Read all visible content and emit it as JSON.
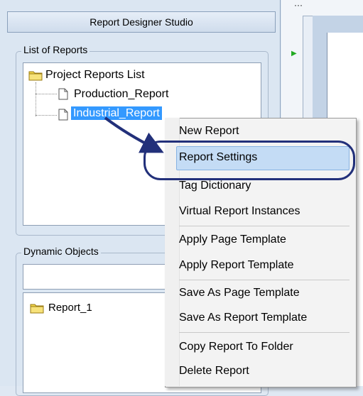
{
  "app": {
    "title": "Report Designer Studio"
  },
  "reports_panel": {
    "legend": "List of Reports",
    "root": "Project Reports List",
    "items": [
      "Production_Report",
      "Industrial_Report"
    ],
    "selected_index": 1
  },
  "dynamic_panel": {
    "legend": "Dynamic Objects",
    "input_value": "",
    "items": [
      "Report_1"
    ]
  },
  "context_menu": {
    "items": [
      "New Report",
      "Report Settings",
      "Tag Dictionary",
      "Virtual Report Instances",
      "Apply Page Template",
      "Apply Report Template",
      "Save As Page Template",
      "Save As Report Template",
      "Copy Report To Folder",
      "Delete Report"
    ],
    "highlighted_index": 1
  },
  "colors": {
    "selection": "#3399ff",
    "callout": "#22307a",
    "menu_highlight": "#c4dcf5"
  }
}
